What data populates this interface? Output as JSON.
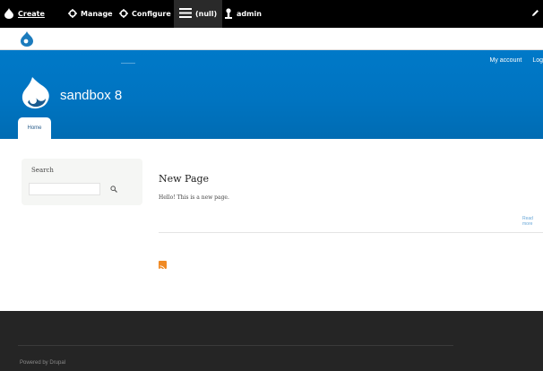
{
  "toolbar": {
    "items": [
      {
        "label": "Create",
        "icon": "drupal-drop-icon"
      },
      {
        "label": "Manage",
        "icon": "gear-icon"
      },
      {
        "label": "Configure",
        "icon": "gear-icon"
      },
      {
        "label": "(null)",
        "icon": "hamburger-icon"
      },
      {
        "label": "admin",
        "icon": "user-icon"
      }
    ],
    "edit_icon": "pencil-icon"
  },
  "header": {
    "secondary_menu": [
      "My account",
      "Log"
    ],
    "site_name": "sandbox 8",
    "tab_home": "Home"
  },
  "sidebar": {
    "search_title": "Search",
    "search_value": "",
    "search_button_icon": "search-icon"
  },
  "content": {
    "title": "New Page",
    "body": "Hello! This is a new page.",
    "read_more": "Read more",
    "feed_icon": "rss-icon"
  },
  "footer": {
    "powered_by": "Powered by Drupal"
  },
  "colors": {
    "toolbar_bg": "#000000",
    "header_blue": "#0077c6",
    "footer_bg": "#252525",
    "rss_orange": "#f08a24"
  }
}
